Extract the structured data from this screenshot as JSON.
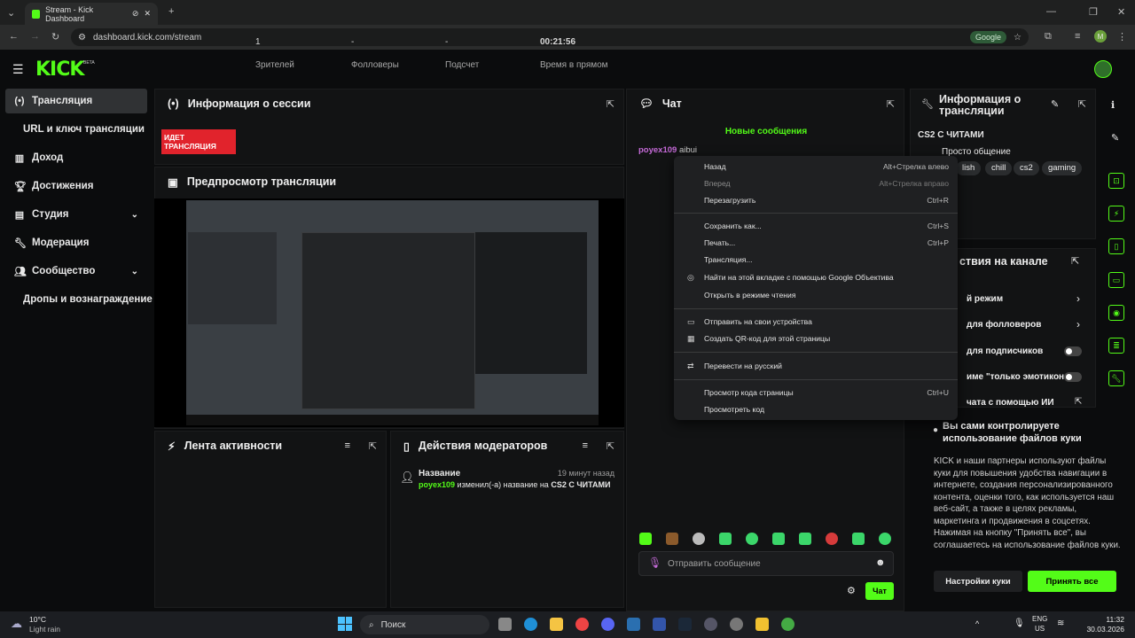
{
  "browser": {
    "tab_title": "Stream - Kick Dashboard",
    "url": "dashboard.kick.com/stream",
    "google_label": "Google",
    "profile_initial": "M"
  },
  "app": {
    "logo": "KICK",
    "beta": "BETA"
  },
  "sidebar": {
    "items": [
      {
        "label": "Трансляция",
        "icon": "broadcast-icon"
      },
      {
        "label": "URL и ключ трансляции",
        "icon": ""
      },
      {
        "label": "Доход",
        "icon": "chart-icon"
      },
      {
        "label": "Достижения",
        "icon": "trophy-icon"
      },
      {
        "label": "Студия",
        "icon": "studio-icon"
      },
      {
        "label": "Модерация",
        "icon": "wrench-icon"
      },
      {
        "label": "Сообщество",
        "icon": "users-icon"
      },
      {
        "label": "Дропы и вознаграждение",
        "icon": ""
      }
    ]
  },
  "session": {
    "title": "Информация о сессии",
    "live_badge": "ИДЕТ ТРАНСЛЯЦИЯ",
    "viewers_value": "1",
    "viewers_label": "Зрителей",
    "followers_value": "-",
    "followers_label": "Фолловеры",
    "subs_value": "-",
    "subs_label": "Подсчет",
    "time_value": "00:21:56",
    "time_label": "Время в прямом"
  },
  "preview": {
    "title": "Предпросмотр трансляции"
  },
  "activity": {
    "title": "Лента активности"
  },
  "mod_actions": {
    "title": "Действия модераторов",
    "entry_title": "Название",
    "entry_time": "19 минут назад",
    "entry_user": "poyex109",
    "entry_text": "изменил(-а) название на",
    "entry_value": "CS2 С ЧИТАМИ"
  },
  "chat": {
    "title": "Чат",
    "new_messages": "Новые сообщения",
    "first_user": "poyex109",
    "first_msg": "aibui",
    "input_placeholder": "Отправить сообщение",
    "send_label": "Чат"
  },
  "stream_info": {
    "title": "Информация о трансляции",
    "stream_title": "CS2 С ЧИТАМИ",
    "category": "Просто общение",
    "tags": [
      "lish",
      "chill",
      "cs2",
      "gaming"
    ]
  },
  "channel_actions": {
    "title": "ствия на канале",
    "items": [
      "й режим",
      "для фолловеров",
      "для подписчиков",
      "име \"только эмотиконы\"",
      "чата с помощью ИИ"
    ]
  },
  "cookie": {
    "title": "Вы сами контролируете использование файлов куки",
    "text": "KICK и наши партнеры используют файлы куки для повышения удобства навигации в интернете, создания персонализированного контента, оценки того, как используется наш веб-сайт, а также в целях рекламы, маркетинга и продвижения в соцсетях. Нажимая на кнопку \"Принять все\", вы соглашаетесь на использование файлов куки.",
    "settings_btn": "Настройки куки",
    "accept_btn": "Принять все"
  },
  "context_menu": {
    "items": [
      {
        "label": "Назад",
        "shortcut": "Alt+Стрелка влево"
      },
      {
        "label": "Вперед",
        "shortcut": "Alt+Стрелка вправо"
      },
      {
        "label": "Перезагрузить",
        "shortcut": "Ctrl+R"
      },
      {
        "label": "Сохранить как...",
        "shortcut": "Ctrl+S"
      },
      {
        "label": "Печать...",
        "shortcut": "Ctrl+P"
      },
      {
        "label": "Трансляция...",
        "shortcut": ""
      },
      {
        "label": "Найти на этой вкладке с помощью Google Объектива",
        "shortcut": ""
      },
      {
        "label": "Открыть в режиме чтения",
        "shortcut": ""
      },
      {
        "label": "Отправить на свои устройства",
        "shortcut": ""
      },
      {
        "label": "Создать QR-код для этой страницы",
        "shortcut": ""
      },
      {
        "label": "Перевести на русский",
        "shortcut": ""
      },
      {
        "label": "Просмотр кода страницы",
        "shortcut": "Ctrl+U"
      },
      {
        "label": "Просмотреть код",
        "shortcut": ""
      }
    ]
  },
  "taskbar": {
    "weather_temp": "10°C",
    "weather_desc": "Light rain",
    "search_label": "Поиск",
    "lang": "ENG",
    "region": "US",
    "time": "11:32",
    "date": "30.03.2026"
  },
  "colors": {
    "accent": "#53fc18",
    "live": "#e1232c"
  }
}
